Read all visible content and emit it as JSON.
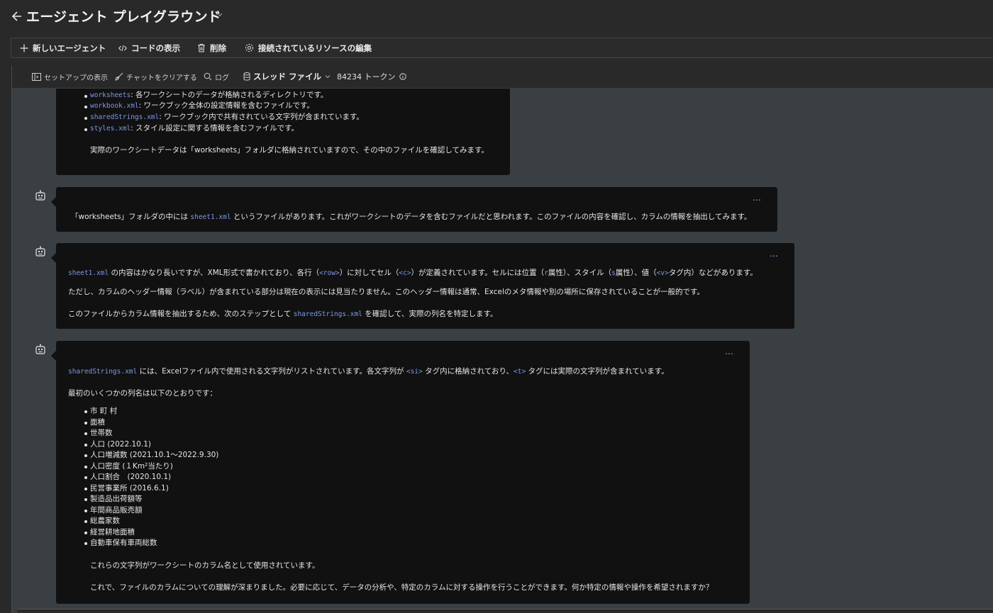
{
  "header": {
    "title": "エージェント プレイグラウンド"
  },
  "toolbar": {
    "new_agent": "新しいエージェント",
    "view_code": "コードの表示",
    "delete": "削除",
    "edit_resources": "接続されているリソースの編集"
  },
  "subtoolbar": {
    "setup": "セットアップの表示",
    "clear_chat": "チャットをクリアする",
    "log": "ログ",
    "thread_files": "スレッド ファイル",
    "tokens": "84234 トークン"
  },
  "messages": {
    "m1": {
      "items": [
        {
          "code": "worksheets",
          "text": ": 各ワークシートのデータが格納されるディレクトリです。"
        },
        {
          "code": "workbook.xml",
          "text": ": ワークブック全体の設定情報を含むファイルです。"
        },
        {
          "code": "sharedStrings.xml",
          "text": ": ワークブック内で共有されている文字列が含まれています。"
        },
        {
          "code": "styles.xml",
          "text": ": スタイル設定に関する情報を含むファイルです。"
        }
      ],
      "para": "実際のワークシートデータは「worksheets」フォルダに格納されていますので、その中のファイルを確認してみます。"
    },
    "m2": {
      "a": "「worksheets」フォルダの中には ",
      "code": "sheet1.xml",
      "b": " というファイルがあります。これがワークシートのデータを含むファイルだと思われます。このファイルの内容を確認し、カラムの情報を抽出してみます。"
    },
    "m3": {
      "p1_code": "sheet1.xml",
      "p1_a": " の内容はかなり長いですが、XML形式で書かれており、各行（",
      "p1_code2": "<row>",
      "p1_b": "）に対してセル（",
      "p1_code3": "<c>",
      "p1_c": "）が定義されています。セルには位置（",
      "p1_code4": "r",
      "p1_d": "属性）、スタイル（",
      "p1_code5": "s",
      "p1_e": "属性）、値（",
      "p1_code6": "<v>",
      "p1_f": "タグ内）などがあります。",
      "p2": "ただし、カラムのヘッダー情報（ラベル）が含まれている部分は現在の表示には見当たりません。このヘッダー情報は通常、Excelのメタ情報や別の場所に保存されていることが一般的です。",
      "p3_a": "このファイルからカラム情報を抽出するため、次のステップとして ",
      "p3_code": "sharedStrings.xml",
      "p3_b": " を確認して、実際の列名を特定します。"
    },
    "m4": {
      "p1_code": "sharedStrings.xml",
      "p1_a": " には、Excelファイル内で使用される文字列がリストされています。各文字列が ",
      "p1_code2": "<si>",
      "p1_b": " タグ内に格納されており、",
      "p1_code3": "<t>",
      "p1_c": " タグには実際の文字列が含まれています。",
      "p2": "最初のいくつかの列名は以下のとおりです：",
      "columns": [
        "市 町 村",
        "面積",
        "世帯数",
        "人口 (2022.10.1)",
        "人口増減数 (2021.10.1～2022.9.30)",
        "人口密度 (１Km²当たり)",
        "人口割合　(2020.10.1)",
        "民営事業所 (2016.6.1)",
        "製造品出荷額等",
        "年間商品販売額",
        "総農家数",
        "経営耕地面積",
        "自動車保有車両総数"
      ],
      "p3": "これらの文字列がワークシートのカラム名として使用されています。",
      "p4": "これで、ファイルのカラムについての理解が深まりました。必要に応じて、データの分析や、特定のカラムに対する操作を行うことができます。何か特定の情報や操作を希望されますか？"
    }
  },
  "more_label": "…",
  "colors": {
    "background": "#292929",
    "panel": "#3a3f44",
    "bubble": "#111111",
    "code": "#7e98ea",
    "accent": "#8aa8ff"
  },
  "icons": [
    "back-arrow-icon",
    "chevron-down-icon",
    "plus-icon",
    "code-icon",
    "trash-icon",
    "gear-icon",
    "setup-panel-icon",
    "broom-icon",
    "search-icon",
    "database-icon",
    "info-icon",
    "bot-icon"
  ]
}
